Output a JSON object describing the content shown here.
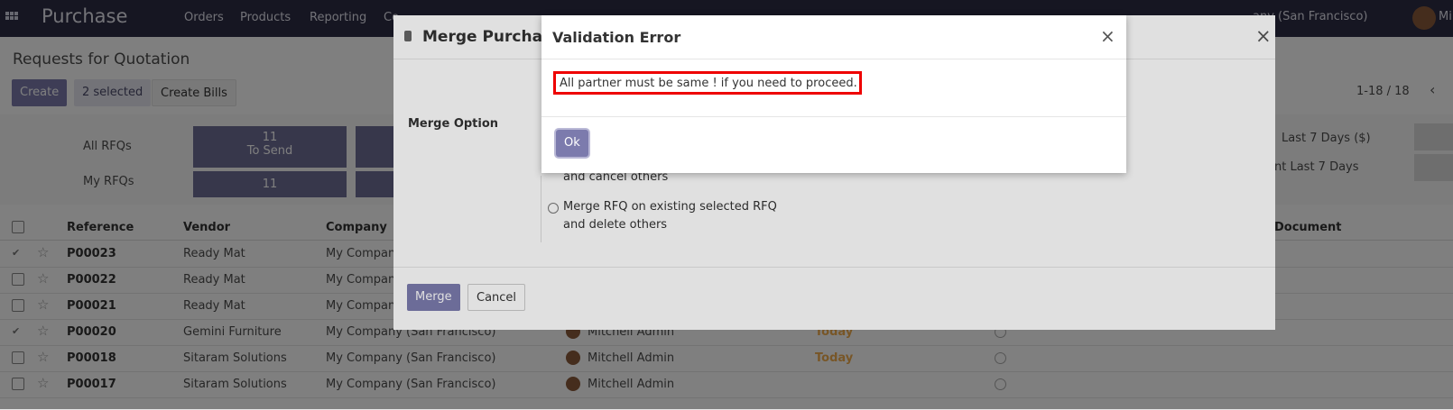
{
  "navbar": {
    "app_title": "Purchase",
    "menu": [
      "Orders",
      "Products",
      "Reporting",
      "Co"
    ],
    "company_partial": "any (San Francisco)",
    "user_partial": "Mi"
  },
  "control_panel": {
    "title": "Requests for Quotation",
    "create_label": "Create",
    "selected_label": "2 selected",
    "create_bills_label": "Create Bills",
    "pager": "1-18 / 18"
  },
  "dashboard": {
    "row1_label": "All RFQs",
    "row2_label": "My RFQs",
    "tile1_count": "11",
    "tile1_caption": "To Send",
    "tile2_count": "11",
    "right1": "Last 7 Days ($)",
    "right2": "nt Last 7 Days"
  },
  "table": {
    "headers": [
      "Reference",
      "Vendor",
      "Company",
      "Document"
    ],
    "rows": [
      {
        "ref": "P00023",
        "vendor": "Ready Mat",
        "company": "My Company",
        "checked": true
      },
      {
        "ref": "P00022",
        "vendor": "Ready Mat",
        "company": "My Compan",
        "checked": false
      },
      {
        "ref": "P00021",
        "vendor": "Ready Mat",
        "company": "My Compan",
        "checked": false
      },
      {
        "ref": "P00020",
        "vendor": "Gemini Furniture",
        "company": "My Company (San Francisco)",
        "user": "Mitchell Admin",
        "deadline": "Today",
        "checked": true
      },
      {
        "ref": "P00018",
        "vendor": "Sitaram Solutions",
        "company": "My Company (San Francisco)",
        "user": "Mitchell Admin",
        "deadline": "Today",
        "checked": false
      },
      {
        "ref": "P00017",
        "vendor": "Sitaram Solutions",
        "company": "My Company (San Francisco)",
        "user": "Mitchell Admin",
        "deadline": "",
        "checked": false
      }
    ]
  },
  "merge_dialog": {
    "title": "Merge Purchas",
    "field_label": "Merge Option",
    "option_partial": "and cancel others",
    "option2_line1": "Merge RFQ on existing selected RFQ",
    "option2_line2": "and delete others",
    "merge_label": "Merge",
    "cancel_label": "Cancel",
    "close_glyph": "×"
  },
  "validation_dialog": {
    "title": "Validation Error",
    "message": "All partner must be same ! if you need to proceed.",
    "ok_label": "Ok",
    "close_glyph": "×",
    "highlight_color": "#ee0000"
  }
}
